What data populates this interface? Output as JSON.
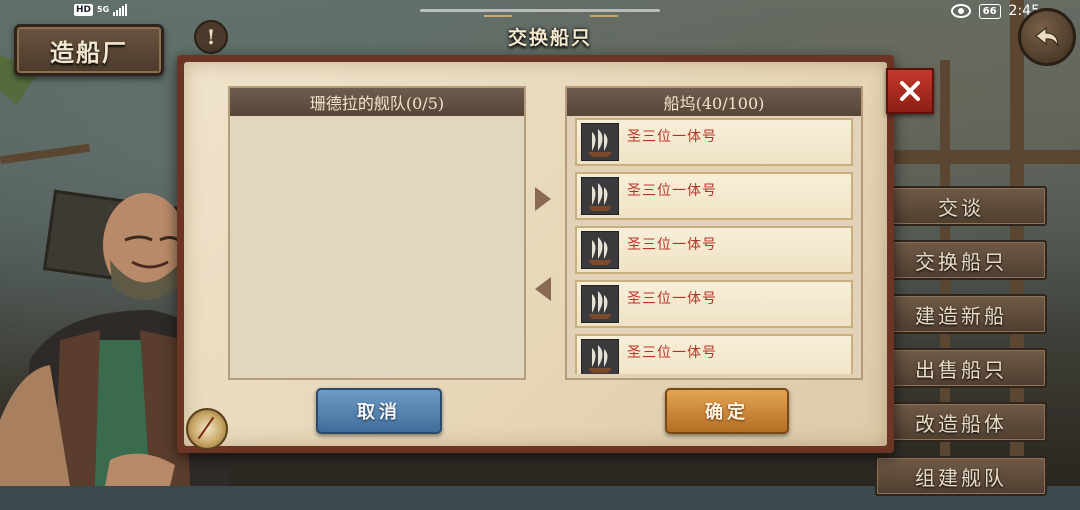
{
  "status_bar": {
    "hd": "HD",
    "network": "5G",
    "battery": "66",
    "time": "2:45"
  },
  "shipyard_sign": "造船厂",
  "alert_icon": "!",
  "dialog": {
    "title": "交换船只",
    "fleet_panel": {
      "title": "珊德拉的舰队(0/5)"
    },
    "dock_panel": {
      "title": "船坞(40/100)",
      "ships": [
        {
          "name": "圣三位一体号"
        },
        {
          "name": "圣三位一体号"
        },
        {
          "name": "圣三位一体号"
        },
        {
          "name": "圣三位一体号"
        },
        {
          "name": "圣三位一体号"
        }
      ]
    },
    "cancel_label": "取消",
    "confirm_label": "确定"
  },
  "side_menu": {
    "items": [
      "交谈",
      "交换船只",
      "建造新船",
      "出售船只",
      "改造船体",
      "组建舰队"
    ]
  },
  "colors": {
    "dialog_frame": "#6b3424",
    "paper": "#efe3cb",
    "ship_name": "#b8322a",
    "cancel_button": "#4f7fae",
    "confirm_button": "#cc8a3a",
    "close_button": "#b3301f"
  },
  "icons": {
    "close": "close-icon",
    "back": "back-arrow-icon",
    "transfer_right": "arrow-right-icon",
    "transfer_left": "arrow-left-icon",
    "compass": "compass-icon"
  }
}
